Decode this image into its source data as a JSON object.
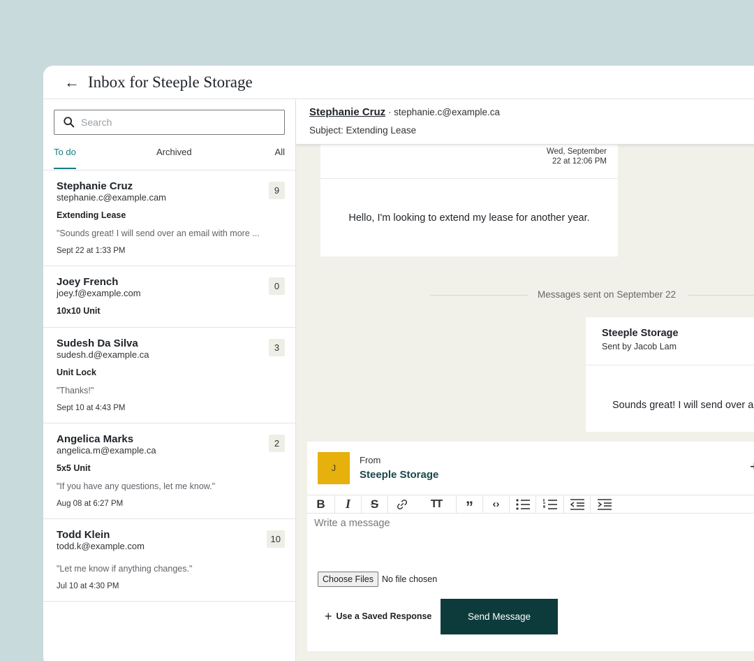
{
  "header": {
    "title": "Inbox for Steeple Storage"
  },
  "search": {
    "placeholder": "Search"
  },
  "tabs": {
    "todo": "To do",
    "archived": "Archived",
    "all": "All"
  },
  "conversations": [
    {
      "name": "Stephanie Cruz",
      "email": "stephanie.c@example.cam",
      "subject": "Extending Lease",
      "preview": "\"Sounds great! I will send over an email with more ...",
      "time": "Sept 22 at 1:33 PM",
      "count": "9"
    },
    {
      "name": "Joey French",
      "email": "joey.f@example.com",
      "subject": "10x10 Unit",
      "preview": "",
      "time": "",
      "count": "0"
    },
    {
      "name": "Sudesh Da Silva",
      "email": "sudesh.d@example.ca",
      "subject": "Unit Lock",
      "preview": "\"Thanks!\"",
      "time": "Sept 10 at 4:43 PM",
      "count": "3"
    },
    {
      "name": "Angelica Marks",
      "email": "angelica.m@example.ca",
      "subject": "5x5 Unit",
      "preview": "\"If you have any questions, let me know.\"",
      "time": "Aug 08 at 6:27 PM",
      "count": "2"
    },
    {
      "name": "Todd Klein",
      "email": "todd.k@example.com",
      "subject": "",
      "preview": "\"Let me know if anything changes.\"",
      "time": "Jul 10 at 4:30 PM",
      "count": "10"
    }
  ],
  "thread": {
    "sender_name": "Stephanie Cruz",
    "sender_email": " · stephanie.c@example.ca",
    "subject": "Subject: Extending Lease",
    "incoming": {
      "date_line1": "Wed, September",
      "date_line2": "22 at 12:06 PM",
      "text": "Hello, I'm looking to extend my lease for another year."
    },
    "day_separator": "Messages sent on September 22",
    "outgoing": {
      "name": "Steeple Storage",
      "sent_by": "Sent by Jacob Lam",
      "text": "Sounds great! I will send over a"
    }
  },
  "composer": {
    "avatar_initial": "J",
    "from_label": "From",
    "from_name": "Steeple Storage",
    "plus": "+",
    "placeholder": "Write a message",
    "file_button": "Choose Files",
    "file_status": "No file chosen",
    "saved_plus": "+",
    "saved_response": "Use a Saved Response",
    "send_label": "Send Message"
  },
  "toolbar": {
    "bold": "B",
    "italic": "I",
    "strike": "S",
    "link": "link-icon",
    "text_size": "TT",
    "quote": "”",
    "code": "‹›",
    "bullet_list": "bullet-list-icon",
    "numbered_list": "numbered-list-icon",
    "outdent": "outdent-icon",
    "indent": "indent-icon"
  },
  "colors": {
    "accent": "#147a82",
    "send_button": "#0d3b3b",
    "avatar": "#e6b10c",
    "main_bg": "#f1f1e9",
    "page_bg": "#c9dadc"
  }
}
